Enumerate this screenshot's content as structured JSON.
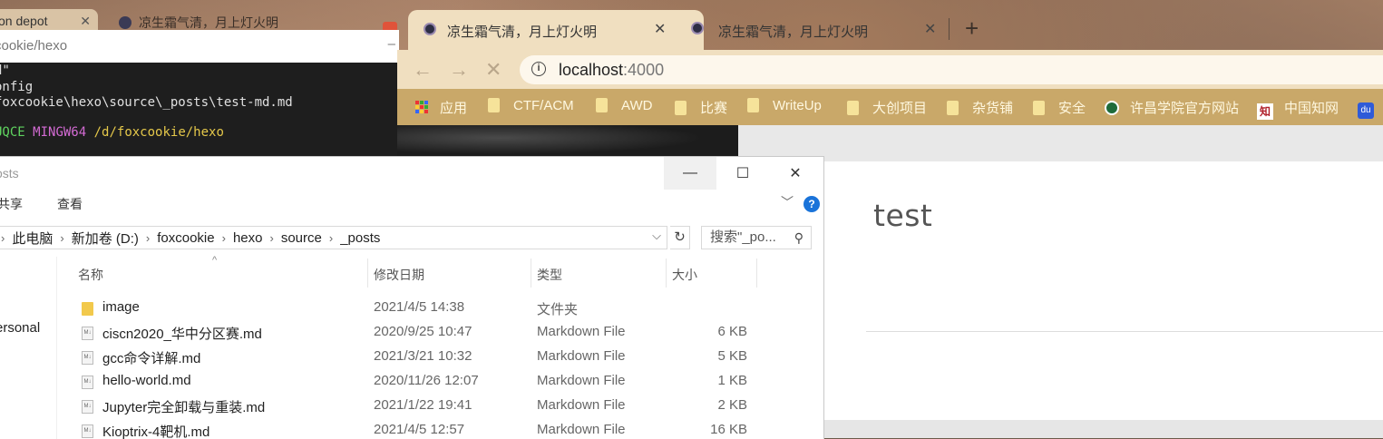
{
  "background_browser": {
    "tab1_title": "on depot",
    "tab2_title": "凉生霜气清，月上灯火明"
  },
  "terminal": {
    "title": "cookie/hexo",
    "lines": [
      "d\"",
      "onfig",
      "foxcookie\\hexo\\source\\_posts\\test-md.md"
    ],
    "prompt_user": "UQCE",
    "prompt_env": "MINGW64",
    "prompt_path": "/d/foxcookie/hexo"
  },
  "explorer": {
    "title": "osts",
    "menu": [
      "共享",
      "查看"
    ],
    "breadcrumb": [
      "此电脑",
      "新加卷 (D:)",
      "foxcookie",
      "hexo",
      "source",
      "_posts"
    ],
    "search_placeholder": "搜索\"_po...",
    "nav_item": "ersonal",
    "columns": {
      "name": "名称",
      "date": "修改日期",
      "type": "类型",
      "size": "大小"
    },
    "files": [
      {
        "name": "image",
        "date": "2021/4/5 14:38",
        "type": "文件夹",
        "size": "",
        "kind": "folder"
      },
      {
        "name": "ciscn2020_华中分区赛.md",
        "date": "2020/9/25 10:47",
        "type": "Markdown File",
        "size": "6 KB",
        "kind": "file"
      },
      {
        "name": "gcc命令详解.md",
        "date": "2021/3/21 10:32",
        "type": "Markdown File",
        "size": "5 KB",
        "kind": "file"
      },
      {
        "name": "hello-world.md",
        "date": "2020/11/26 12:07",
        "type": "Markdown File",
        "size": "1 KB",
        "kind": "file"
      },
      {
        "name": "Jupyter完全卸载与重装.md",
        "date": "2021/1/22 19:41",
        "type": "Markdown File",
        "size": "2 KB",
        "kind": "file"
      },
      {
        "name": "Kioptrix-4靶机.md",
        "date": "2021/4/5 12:57",
        "type": "Markdown File",
        "size": "16 KB",
        "kind": "file"
      }
    ]
  },
  "browser": {
    "tabs": [
      {
        "title": "凉生霜气清，月上灯火明",
        "active": true
      },
      {
        "title": "凉生霜气清，月上灯火明",
        "active": false
      }
    ],
    "url_host": "localhost",
    "url_port": ":4000",
    "bookmarks": [
      "应用",
      "CTF/ACM",
      "AWD",
      "比赛",
      "WriteUp",
      "大创项目",
      "杂货铺",
      "安全",
      "许昌学院官方网站",
      "中国知网"
    ],
    "page_title": "test"
  },
  "colors": {
    "chrome_frame": "#f0dfc0",
    "bookmarks_bar": "#c9a869",
    "terminal_bg": "#1e1e1e"
  }
}
